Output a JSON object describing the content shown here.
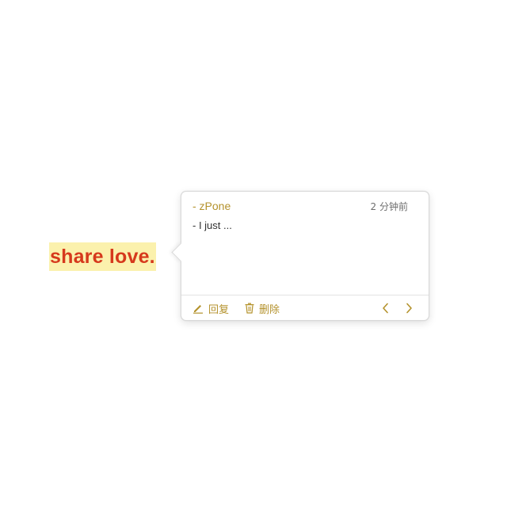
{
  "document": {
    "highlighted_text": "share love."
  },
  "comment_popover": {
    "author": "- zPone",
    "timestamp": "2 分钟前",
    "comment_text": "- I just ...",
    "actions": {
      "reply_label": "回复",
      "delete_label": "删除"
    },
    "icons": {
      "reply": "pencil-icon",
      "delete": "trash-icon",
      "previous": "chevron-left-icon",
      "next": "chevron-right-icon"
    }
  },
  "colors": {
    "highlight_background": "#fbf1ad",
    "highlight_text": "#d6391c",
    "accent": "#b4922c"
  }
}
